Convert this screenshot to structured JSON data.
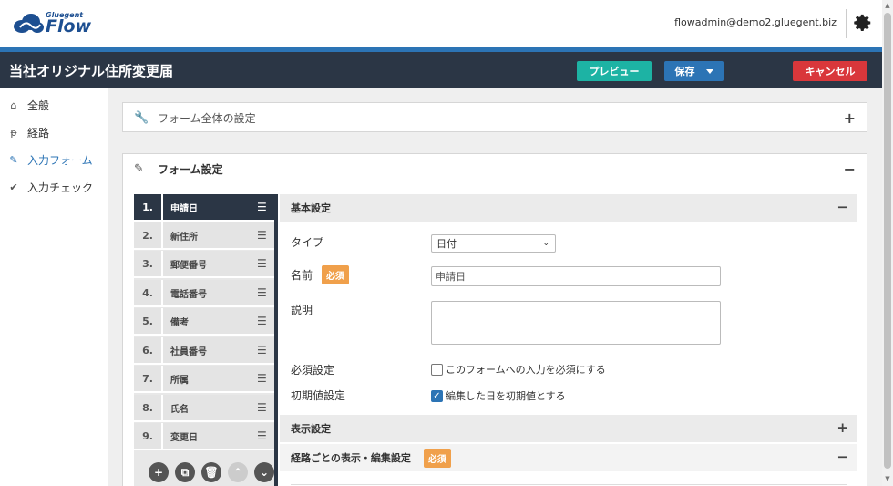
{
  "header": {
    "logo_small": "Gluegent",
    "logo_main": "Flow",
    "user_email": "flowadmin@demo2.gluegent.biz",
    "page_title": "当社オリジナル住所変更届",
    "preview_label": "プレビュー",
    "save_label": "保存",
    "cancel_label": "キャンセル"
  },
  "sidebar": {
    "items": [
      {
        "label": "全般",
        "icon": "home-icon"
      },
      {
        "label": "経路",
        "icon": "route-icon"
      },
      {
        "label": "入力フォーム",
        "icon": "pencil-icon",
        "active": true
      },
      {
        "label": "入力チェック",
        "icon": "check-icon"
      }
    ]
  },
  "panels": {
    "overall": {
      "title": "フォーム全体の設定",
      "toggle": "+"
    },
    "form": {
      "title": "フォーム設定",
      "toggle": "−"
    }
  },
  "fields": [
    {
      "num": "1.",
      "label": "申請日"
    },
    {
      "num": "2.",
      "label": "新住所"
    },
    {
      "num": "3.",
      "label": "郵便番号"
    },
    {
      "num": "4.",
      "label": "電話番号"
    },
    {
      "num": "5.",
      "label": "備考"
    },
    {
      "num": "6.",
      "label": "社員番号"
    },
    {
      "num": "7.",
      "label": "所属"
    },
    {
      "num": "8.",
      "label": "氏名"
    },
    {
      "num": "9.",
      "label": "変更日"
    }
  ],
  "basic": {
    "section_title": "基本設定",
    "toggle": "−",
    "type_label": "タイプ",
    "type_value": "日付",
    "name_label": "名前",
    "required_badge": "必須",
    "name_value": "申請日",
    "desc_label": "説明",
    "required_setting_label": "必須設定",
    "required_check_text": "このフォームへの入力を必須にする",
    "initial_label": "初期値設定",
    "initial_check_text": "編集した日を初期値とする"
  },
  "display": {
    "section_title": "表示設定",
    "toggle": "+"
  },
  "route_display": {
    "section_title": "経路ごとの表示・編集設定",
    "badge": "必須",
    "toggle": "−"
  },
  "colors": {
    "dark": "#2b3645",
    "accent_blue": "#2c74b5",
    "teal": "#1db3a4",
    "red": "#d9373b",
    "badge": "#f0a04b"
  }
}
